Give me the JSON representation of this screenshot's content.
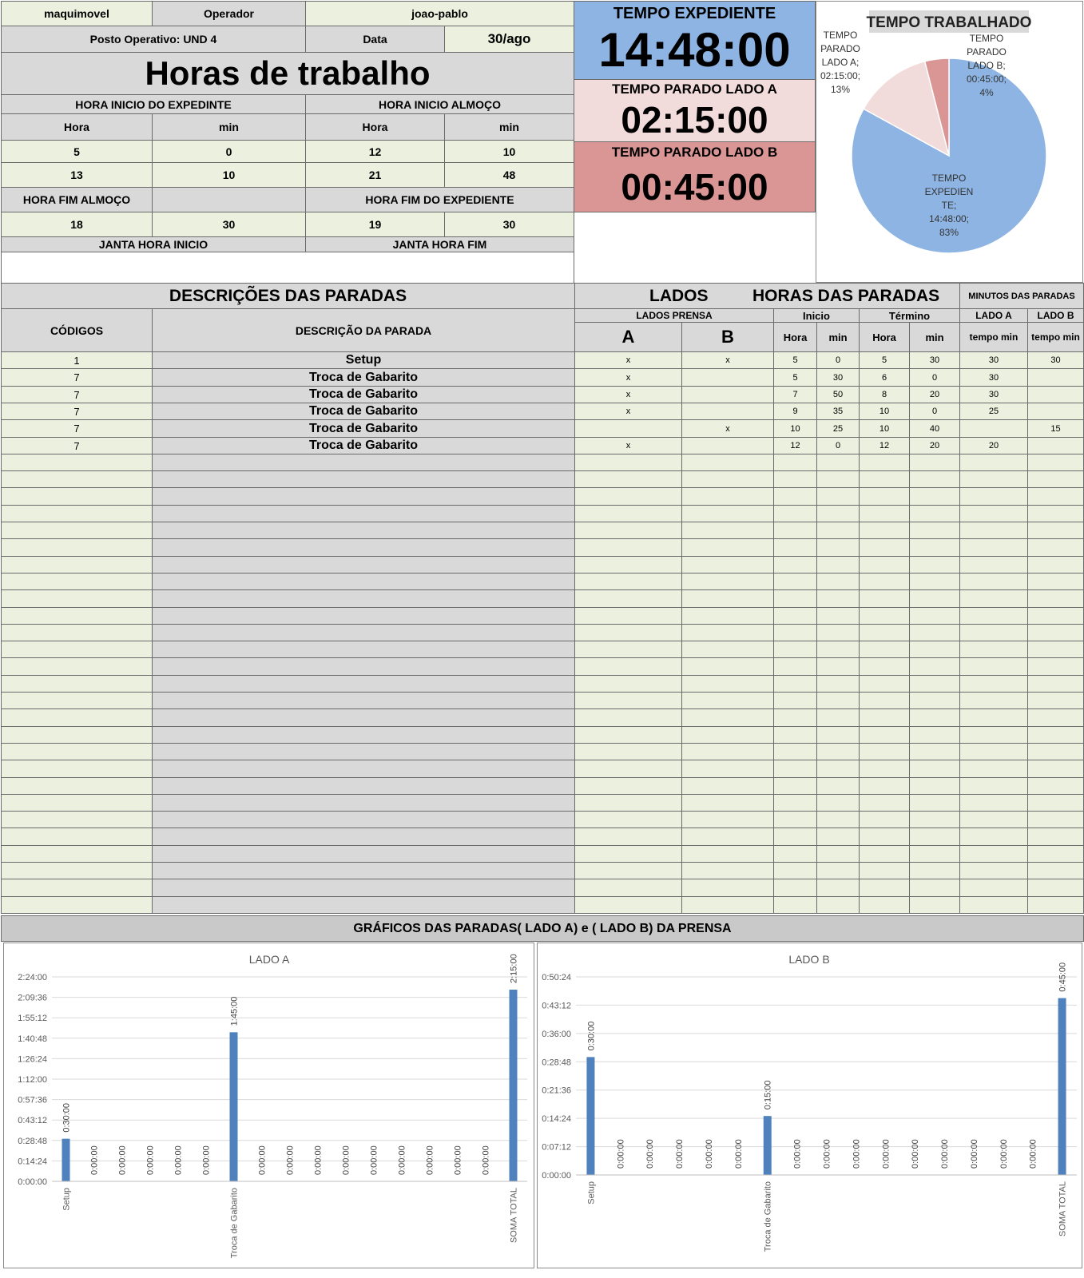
{
  "header": {
    "company": "maquimovel",
    "operator_label": "Operador",
    "operator_value": "joao-pablo",
    "posto": "Posto Operativo: UND 4",
    "date_label": "Data",
    "date_value": "30/ago",
    "title": "Horas de trabalho"
  },
  "schedule": {
    "inicio_expediente_label": "HORA INICIO DO EXPEDINTE",
    "inicio_almoco_label": "HORA INICIO ALMOÇO",
    "hora_label": "Hora",
    "min_label": "min",
    "row1": [
      "5",
      "0",
      "12",
      "10"
    ],
    "row2": [
      "13",
      "10",
      "21",
      "48"
    ],
    "fim_almoco_label": "HORA FIM ALMOÇO",
    "fim_expediente_label": "HORA FIM DO EXPEDIENTE",
    "row3": [
      "18",
      "30",
      "19",
      "30"
    ],
    "janta_inicio_label": "JANTA HORA INICIO",
    "janta_fim_label": "JANTA HORA FIM"
  },
  "summary": {
    "expediente_label": "TEMPO EXPEDIENTE",
    "expediente_value": "14:48:00",
    "parado_a_label": "TEMPO PARADO LADO A",
    "parado_a_value": "02:15:00",
    "parado_b_label": "TEMPO PARADO LADO B",
    "parado_b_value": "00:45:00"
  },
  "pie": {
    "title": "TEMPO TRABALHADO",
    "slices": [
      {
        "label": [
          "TEMPO",
          "EXPEDIEN",
          "TE;",
          "14:48:00;",
          "83%"
        ],
        "value": 83,
        "color": "#8db4e2"
      },
      {
        "label": [
          "TEMPO",
          "PARADO",
          "LADO A;",
          "02:15:00;",
          "13%"
        ],
        "value": 13,
        "color": "#f2dcdb"
      },
      {
        "label": [
          "TEMPO",
          "PARADO",
          "LADO B;",
          "00:45:00;",
          "4%"
        ],
        "value": 4,
        "color": "#da9694"
      }
    ]
  },
  "stops": {
    "title_desc": "DESCRIÇÕES DAS PARADAS",
    "title_lados": "LADOS",
    "title_horas": "HORAS DAS PARADAS",
    "title_minutos": "MINUTOS DAS PARADAS",
    "col_codigos": "CÓDIGOS",
    "col_descricao": "DESCRIÇÃO DA PARADA",
    "lados_prensa": "LADOS PRENSA",
    "inicio": "Inicio",
    "termino": "Término",
    "lado_a": "LADO A",
    "lado_b": "LADO B",
    "a": "A",
    "b": "B",
    "hora": "Hora",
    "min": "min",
    "tempo_min": "tempo min",
    "rows": [
      [
        "1",
        "Setup",
        "x",
        "x",
        "5",
        "0",
        "5",
        "30",
        "30",
        "30"
      ],
      [
        "7",
        "Troca de Gabarito",
        "x",
        "",
        "5",
        "30",
        "6",
        "0",
        "30",
        ""
      ],
      [
        "7",
        "Troca de Gabarito",
        "x",
        "",
        "7",
        "50",
        "8",
        "20",
        "30",
        ""
      ],
      [
        "7",
        "Troca de Gabarito",
        "x",
        "",
        "9",
        "35",
        "10",
        "0",
        "25",
        ""
      ],
      [
        "7",
        "Troca de Gabarito",
        "",
        "x",
        "10",
        "25",
        "10",
        "40",
        "",
        "15"
      ],
      [
        "7",
        "Troca de Gabarito",
        "x",
        "",
        "12",
        "0",
        "12",
        "20",
        "20",
        ""
      ]
    ],
    "empty_rows": 27
  },
  "charts_header": "GRÁFICOS DAS PARADAS( LADO A) e ( LADO B) DA PRENSA",
  "chart_data": [
    {
      "type": "bar",
      "title": "LADO A",
      "categories": [
        "Setup",
        "",
        "",
        "",
        "",
        "",
        "Troca de Gabarito",
        "",
        "",
        "",
        "",
        "",
        "",
        "",
        "",
        "",
        "SOMA TOTAL"
      ],
      "values": [
        30,
        0,
        0,
        0,
        0,
        0,
        105,
        0,
        0,
        0,
        0,
        0,
        0,
        0,
        0,
        0,
        135
      ],
      "data_labels": [
        "0:30:00",
        "0:00:00",
        "0:00:00",
        "0:00:00",
        "0:00:00",
        "0:00:00",
        "1:45:00",
        "0:00:00",
        "0:00:00",
        "0:00:00",
        "0:00:00",
        "0:00:00",
        "0:00:00",
        "0:00:00",
        "0:00:00",
        "0:00:00",
        "2:15:00"
      ],
      "yticks": [
        "0:00:00",
        "0:14:24",
        "0:28:48",
        "0:43:12",
        "0:57:36",
        "1:12:00",
        "1:26:24",
        "1:40:48",
        "1:55:12",
        "2:09:36",
        "2:24:00"
      ],
      "ylim": [
        0,
        144
      ],
      "color": "#4f81bd"
    },
    {
      "type": "bar",
      "title": "LADO B",
      "categories": [
        "Setup",
        "",
        "",
        "",
        "",
        "",
        "Troca de Gabarito",
        "",
        "",
        "",
        "",
        "",
        "",
        "",
        "",
        "",
        "SOMA TOTAL"
      ],
      "values": [
        30,
        0,
        0,
        0,
        0,
        0,
        15,
        0,
        0,
        0,
        0,
        0,
        0,
        0,
        0,
        0,
        45
      ],
      "data_labels": [
        "0:30:00",
        "0:00:00",
        "0:00:00",
        "0:00:00",
        "0:00:00",
        "0:00:00",
        "0:15:00",
        "0:00:00",
        "0:00:00",
        "0:00:00",
        "0:00:00",
        "0:00:00",
        "0:00:00",
        "0:00:00",
        "0:00:00",
        "0:00:00",
        "0:45:00"
      ],
      "yticks": [
        "0:00:00",
        "0:07:12",
        "0:14:24",
        "0:21:36",
        "0:28:48",
        "0:36:00",
        "0:43:12",
        "0:50:24"
      ],
      "ylim": [
        0,
        50.4
      ],
      "color": "#4f81bd"
    }
  ]
}
